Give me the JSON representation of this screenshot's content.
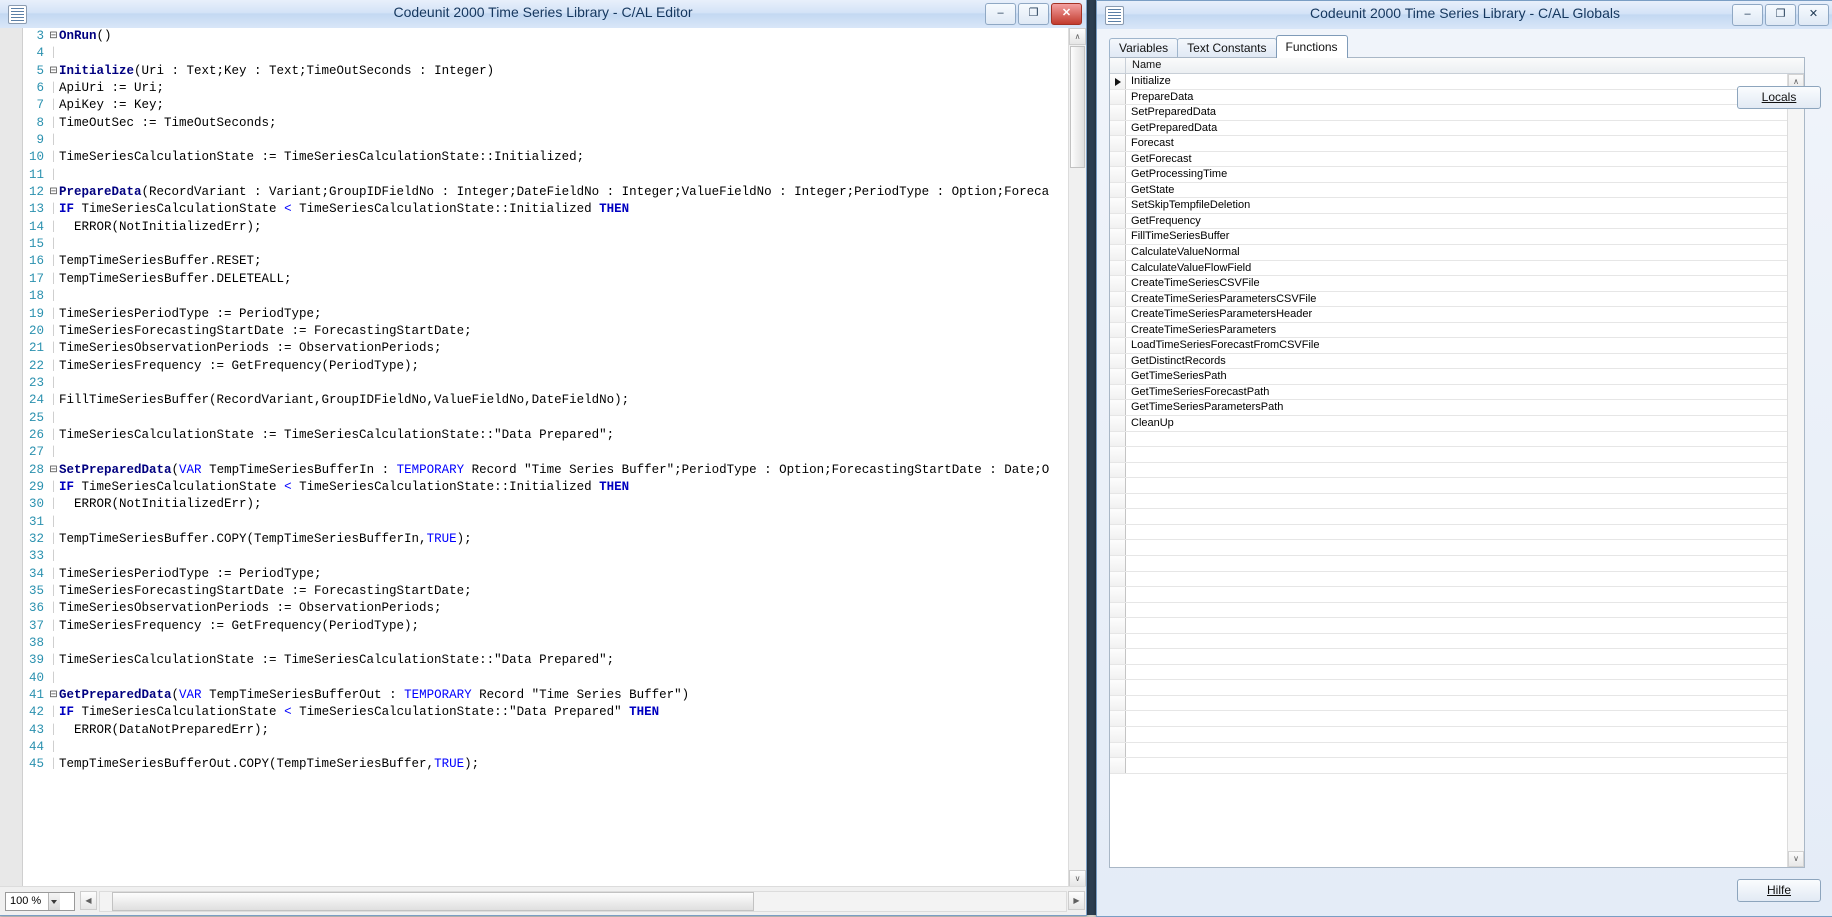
{
  "editor": {
    "title": "Codeunit 2000 Time Series Library - C/AL Editor",
    "icon": "codeunit-icon",
    "minimize_label": "–",
    "maximize_label": "❐",
    "close_label": "✕",
    "zoom_value": "100 %",
    "scroll_left_arrow": "◀",
    "scroll_right_arrow": "▶",
    "scroll_up_arrow": "∧",
    "scroll_down_arrow": "∨",
    "lines": [
      {
        "n": "3",
        "fold": "⊟",
        "guide": "",
        "tokens": [
          {
            "t": "OnRun",
            "c": "fname"
          },
          {
            "t": "()",
            "c": "codetxt"
          }
        ]
      },
      {
        "n": "4",
        "fold": "",
        "guide": "|",
        "tokens": []
      },
      {
        "n": "5",
        "fold": "⊟",
        "guide": "",
        "tokens": [
          {
            "t": "Initialize",
            "c": "fname"
          },
          {
            "t": "(Uri : Text;Key : Text;TimeOutSeconds : Integer)",
            "c": "codetxt"
          }
        ]
      },
      {
        "n": "6",
        "fold": "",
        "guide": "|",
        "tokens": [
          {
            "t": "ApiUri := Uri;",
            "c": "codetxt"
          }
        ]
      },
      {
        "n": "7",
        "fold": "",
        "guide": "|",
        "tokens": [
          {
            "t": "ApiKey := Key;",
            "c": "codetxt"
          }
        ]
      },
      {
        "n": "8",
        "fold": "",
        "guide": "|",
        "tokens": [
          {
            "t": "TimeOutSec := TimeOutSeconds;",
            "c": "codetxt"
          }
        ]
      },
      {
        "n": "9",
        "fold": "",
        "guide": "|",
        "tokens": []
      },
      {
        "n": "10",
        "fold": "",
        "guide": "|",
        "tokens": [
          {
            "t": "TimeSeriesCalculationState := TimeSeriesCalculationState::Initialized;",
            "c": "codetxt"
          }
        ]
      },
      {
        "n": "11",
        "fold": "",
        "guide": "|",
        "tokens": []
      },
      {
        "n": "12",
        "fold": "⊟",
        "guide": "",
        "tokens": [
          {
            "t": "PrepareData",
            "c": "fname"
          },
          {
            "t": "(RecordVariant : Variant;GroupIDFieldNo : Integer;DateFieldNo : Integer;ValueFieldNo : Integer;PeriodType : Option;Foreca",
            "c": "codetxt"
          }
        ]
      },
      {
        "n": "13",
        "fold": "",
        "guide": "|",
        "tokens": [
          {
            "t": "IF",
            "c": "kw"
          },
          {
            "t": " TimeSeriesCalculationState ",
            "c": "codetxt"
          },
          {
            "t": "<",
            "c": "kw2"
          },
          {
            "t": " TimeSeriesCalculationState::Initialized ",
            "c": "codetxt"
          },
          {
            "t": "THEN",
            "c": "kw"
          }
        ]
      },
      {
        "n": "14",
        "fold": "",
        "guide": "|",
        "tokens": [
          {
            "t": "  ERROR(NotInitializedErr);",
            "c": "codetxt"
          }
        ]
      },
      {
        "n": "15",
        "fold": "",
        "guide": "|",
        "tokens": []
      },
      {
        "n": "16",
        "fold": "",
        "guide": "|",
        "tokens": [
          {
            "t": "TempTimeSeriesBuffer.RESET;",
            "c": "codetxt"
          }
        ]
      },
      {
        "n": "17",
        "fold": "",
        "guide": "|",
        "tokens": [
          {
            "t": "TempTimeSeriesBuffer.DELETEALL;",
            "c": "codetxt"
          }
        ]
      },
      {
        "n": "18",
        "fold": "",
        "guide": "|",
        "tokens": []
      },
      {
        "n": "19",
        "fold": "",
        "guide": "|",
        "tokens": [
          {
            "t": "TimeSeriesPeriodType := PeriodType;",
            "c": "codetxt"
          }
        ]
      },
      {
        "n": "20",
        "fold": "",
        "guide": "|",
        "tokens": [
          {
            "t": "TimeSeriesForecastingStartDate := ForecastingStartDate;",
            "c": "codetxt"
          }
        ]
      },
      {
        "n": "21",
        "fold": "",
        "guide": "|",
        "tokens": [
          {
            "t": "TimeSeriesObservationPeriods := ObservationPeriods;",
            "c": "codetxt"
          }
        ]
      },
      {
        "n": "22",
        "fold": "",
        "guide": "|",
        "tokens": [
          {
            "t": "TimeSeriesFrequency := GetFrequency(PeriodType);",
            "c": "codetxt"
          }
        ]
      },
      {
        "n": "23",
        "fold": "",
        "guide": "|",
        "tokens": []
      },
      {
        "n": "24",
        "fold": "",
        "guide": "|",
        "tokens": [
          {
            "t": "FillTimeSeriesBuffer(RecordVariant,GroupIDFieldNo,ValueFieldNo,DateFieldNo);",
            "c": "codetxt"
          }
        ]
      },
      {
        "n": "25",
        "fold": "",
        "guide": "|",
        "tokens": []
      },
      {
        "n": "26",
        "fold": "",
        "guide": "|",
        "tokens": [
          {
            "t": "TimeSeriesCalculationState := TimeSeriesCalculationState::\"Data Prepared\";",
            "c": "codetxt"
          }
        ]
      },
      {
        "n": "27",
        "fold": "",
        "guide": "|",
        "tokens": []
      },
      {
        "n": "28",
        "fold": "⊟",
        "guide": "",
        "tokens": [
          {
            "t": "SetPreparedData",
            "c": "fname"
          },
          {
            "t": "(",
            "c": "codetxt"
          },
          {
            "t": "VAR",
            "c": "kw2"
          },
          {
            "t": " TempTimeSeriesBufferIn : ",
            "c": "codetxt"
          },
          {
            "t": "TEMPORARY",
            "c": "kw2"
          },
          {
            "t": " Record \"Time Series Buffer\";PeriodType : Option;ForecastingStartDate : Date;O",
            "c": "codetxt"
          }
        ]
      },
      {
        "n": "29",
        "fold": "",
        "guide": "|",
        "tokens": [
          {
            "t": "IF",
            "c": "kw"
          },
          {
            "t": " TimeSeriesCalculationState ",
            "c": "codetxt"
          },
          {
            "t": "<",
            "c": "kw2"
          },
          {
            "t": " TimeSeriesCalculationState::Initialized ",
            "c": "codetxt"
          },
          {
            "t": "THEN",
            "c": "kw"
          }
        ]
      },
      {
        "n": "30",
        "fold": "",
        "guide": "|",
        "tokens": [
          {
            "t": "  ERROR(NotInitializedErr);",
            "c": "codetxt"
          }
        ]
      },
      {
        "n": "31",
        "fold": "",
        "guide": "|",
        "tokens": []
      },
      {
        "n": "32",
        "fold": "",
        "guide": "|",
        "tokens": [
          {
            "t": "TempTimeSeriesBuffer.COPY(TempTimeSeriesBufferIn,",
            "c": "codetxt"
          },
          {
            "t": "TRUE",
            "c": "kw2"
          },
          {
            "t": ");",
            "c": "codetxt"
          }
        ]
      },
      {
        "n": "33",
        "fold": "",
        "guide": "|",
        "tokens": []
      },
      {
        "n": "34",
        "fold": "",
        "guide": "|",
        "tokens": [
          {
            "t": "TimeSeriesPeriodType := PeriodType;",
            "c": "codetxt"
          }
        ]
      },
      {
        "n": "35",
        "fold": "",
        "guide": "|",
        "tokens": [
          {
            "t": "TimeSeriesForecastingStartDate := ForecastingStartDate;",
            "c": "codetxt"
          }
        ]
      },
      {
        "n": "36",
        "fold": "",
        "guide": "|",
        "tokens": [
          {
            "t": "TimeSeriesObservationPeriods := ObservationPeriods;",
            "c": "codetxt"
          }
        ]
      },
      {
        "n": "37",
        "fold": "",
        "guide": "|",
        "tokens": [
          {
            "t": "TimeSeriesFrequency := GetFrequency(PeriodType);",
            "c": "codetxt"
          }
        ]
      },
      {
        "n": "38",
        "fold": "",
        "guide": "|",
        "tokens": []
      },
      {
        "n": "39",
        "fold": "",
        "guide": "|",
        "tokens": [
          {
            "t": "TimeSeriesCalculationState := TimeSeriesCalculationState::\"Data Prepared\";",
            "c": "codetxt"
          }
        ]
      },
      {
        "n": "40",
        "fold": "",
        "guide": "|",
        "tokens": []
      },
      {
        "n": "41",
        "fold": "⊟",
        "guide": "",
        "tokens": [
          {
            "t": "GetPreparedData",
            "c": "fname"
          },
          {
            "t": "(",
            "c": "codetxt"
          },
          {
            "t": "VAR",
            "c": "kw2"
          },
          {
            "t": " TempTimeSeriesBufferOut : ",
            "c": "codetxt"
          },
          {
            "t": "TEMPORARY",
            "c": "kw2"
          },
          {
            "t": " Record \"Time Series Buffer\")",
            "c": "codetxt"
          }
        ]
      },
      {
        "n": "42",
        "fold": "",
        "guide": "|",
        "tokens": [
          {
            "t": "IF",
            "c": "kw"
          },
          {
            "t": " TimeSeriesCalculationState ",
            "c": "codetxt"
          },
          {
            "t": "<",
            "c": "kw2"
          },
          {
            "t": " TimeSeriesCalculationState::\"Data Prepared\" ",
            "c": "codetxt"
          },
          {
            "t": "THEN",
            "c": "kw"
          }
        ]
      },
      {
        "n": "43",
        "fold": "",
        "guide": "|",
        "tokens": [
          {
            "t": "  ERROR(DataNotPreparedErr);",
            "c": "codetxt"
          }
        ]
      },
      {
        "n": "44",
        "fold": "",
        "guide": "|",
        "tokens": []
      },
      {
        "n": "45",
        "fold": "",
        "guide": "|",
        "tokens": [
          {
            "t": "TempTimeSeriesBufferOut.COPY(TempTimeSeriesBuffer,",
            "c": "codetxt"
          },
          {
            "t": "TRUE",
            "c": "kw2"
          },
          {
            "t": ");",
            "c": "codetxt"
          }
        ]
      }
    ]
  },
  "globals": {
    "title": "Codeunit 2000 Time Series Library - C/AL Globals",
    "icon": "codeunit-icon",
    "minimize_label": "–",
    "maximize_label": "❐",
    "close_label": "✕",
    "tabs": [
      {
        "label": "Variables",
        "active": false
      },
      {
        "label": "Text Constants",
        "active": false
      },
      {
        "label": "Functions",
        "active": true
      }
    ],
    "grid": {
      "column_header": "Name",
      "current_row_marker": "▶",
      "rows": [
        "Initialize",
        "PrepareData",
        "SetPreparedData",
        "GetPreparedData",
        "Forecast",
        "GetForecast",
        "GetProcessingTime",
        "GetState",
        "SetSkipTempfileDeletion",
        "GetFrequency",
        "FillTimeSeriesBuffer",
        "CalculateValueNormal",
        "CalculateValueFlowField",
        "CreateTimeSeriesCSVFile",
        "CreateTimeSeriesParametersCSVFile",
        "CreateTimeSeriesParametersHeader",
        "CreateTimeSeriesParameters",
        "LoadTimeSeriesForecastFromCSVFile",
        "GetDistinctRecords",
        "GetTimeSeriesPath",
        "GetTimeSeriesForecastPath",
        "GetTimeSeriesParametersPath",
        "CleanUp"
      ],
      "empty_row_count": 22,
      "scroll_up_arrow": "∧",
      "scroll_down_arrow": "∨"
    },
    "locals_button": "Locals",
    "help_button": "Hilfe"
  }
}
